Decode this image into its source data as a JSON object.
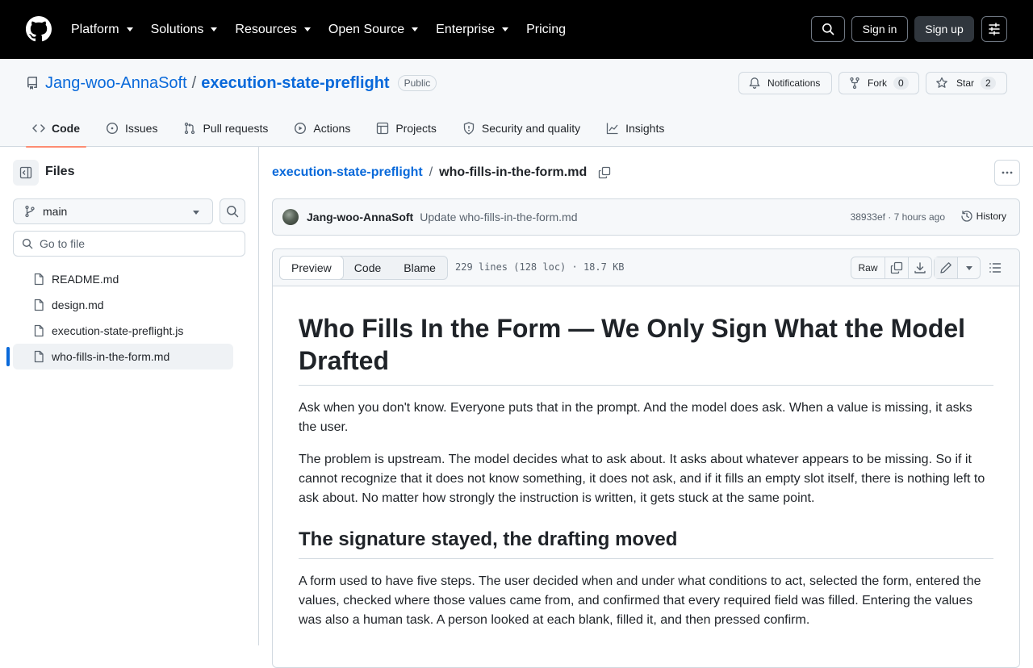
{
  "topnav": {
    "items": [
      {
        "label": "Platform",
        "dropdown": true
      },
      {
        "label": "Solutions",
        "dropdown": true
      },
      {
        "label": "Resources",
        "dropdown": true
      },
      {
        "label": "Open Source",
        "dropdown": true
      },
      {
        "label": "Enterprise",
        "dropdown": true
      },
      {
        "label": "Pricing",
        "dropdown": false
      }
    ],
    "signin": "Sign in",
    "signup": "Sign up"
  },
  "repo": {
    "owner": "Jang-woo-AnnaSoft",
    "separator": "/",
    "name": "execution-state-preflight",
    "visibility": "Public",
    "notifications_label": "Notifications",
    "fork_label": "Fork",
    "fork_count": "0",
    "star_label": "Star",
    "star_count": "2"
  },
  "tabs": [
    {
      "label": "Code",
      "icon": "code-icon",
      "active": true
    },
    {
      "label": "Issues",
      "icon": "issue-icon"
    },
    {
      "label": "Pull requests",
      "icon": "pull-request-icon"
    },
    {
      "label": "Actions",
      "icon": "play-icon"
    },
    {
      "label": "Projects",
      "icon": "table-icon"
    },
    {
      "label": "Security and quality",
      "icon": "shield-icon"
    },
    {
      "label": "Insights",
      "icon": "graph-icon"
    }
  ],
  "sidebar": {
    "title": "Files",
    "branch": "main",
    "goto_placeholder": "Go to file",
    "files": [
      {
        "name": "README.md"
      },
      {
        "name": "design.md"
      },
      {
        "name": "execution-state-preflight.js"
      },
      {
        "name": "who-fills-in-the-form.md",
        "active": true
      }
    ]
  },
  "breadcrumb": {
    "repo": "execution-state-preflight",
    "sep": "/",
    "file": "who-fills-in-the-form.md"
  },
  "commit": {
    "author": "Jang-woo-AnnaSoft",
    "message": "Update who-fills-in-the-form.md",
    "meta": "38933ef · 7 hours ago",
    "history": "History"
  },
  "file_toolbar": {
    "tabs": [
      "Preview",
      "Code",
      "Blame"
    ],
    "active_tab": "Preview",
    "info": "229 lines (128 loc) · 18.7 KB",
    "raw": "Raw"
  },
  "content": {
    "h1": "Who Fills In the Form — We Only Sign What the Model Drafted",
    "p1": "Ask when you don't know. Everyone puts that in the prompt. And the model does ask. When a value is missing, it asks the user.",
    "p2": "The problem is upstream. The model decides what to ask about. It asks about whatever appears to be missing. So if it cannot recognize that it does not know something, it does not ask, and if it fills an empty slot itself, there is nothing left to ask about. No matter how strongly the instruction is written, it gets stuck at the same point.",
    "h2": "The signature stayed, the drafting moved",
    "p3": "A form used to have five steps. The user decided when and under what conditions to act, selected the form, entered the values, checked where those values came from, and confirmed that every required field was filled. Entering the values was also a human task. A person looked at each blank, filled it, and then pressed confirm."
  }
}
